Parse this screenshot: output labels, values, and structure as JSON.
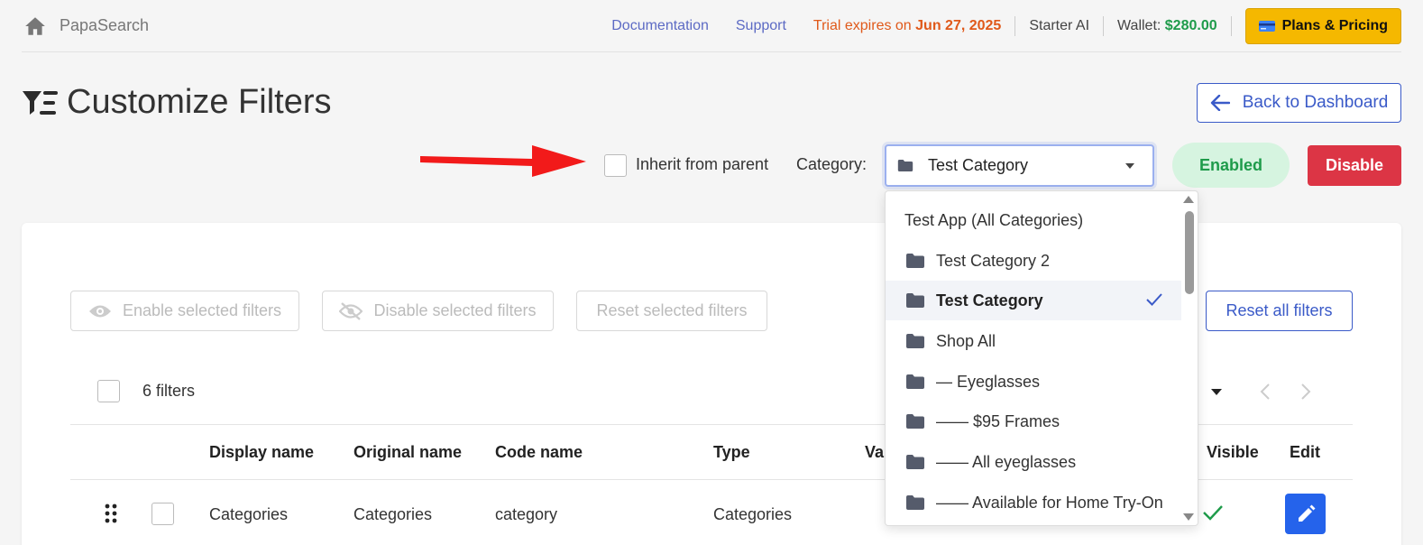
{
  "topbar": {
    "brand": "PapaSearch",
    "documentation": "Documentation",
    "support": "Support",
    "trial_prefix": "Trial expires on ",
    "trial_date": "Jun 27, 2025",
    "plan": "Starter AI",
    "wallet_label": "Wallet: ",
    "wallet_value": "$280.00",
    "plans_button": "Plans & Pricing"
  },
  "header": {
    "title": "Customize Filters",
    "back_button": "Back to Dashboard"
  },
  "controls": {
    "inherit_label": "Inherit from parent",
    "category_label": "Category:",
    "category_value": "Test Category",
    "status_badge": "Enabled",
    "disable_button": "Disable"
  },
  "actions": {
    "enable_selected": "Enable selected filters",
    "disable_selected": "Disable selected filters",
    "reset_selected": "Reset selected filters",
    "reset_all": "Reset all filters"
  },
  "list": {
    "count": "6 filters"
  },
  "table": {
    "headers": {
      "display_name": "Display name",
      "original_name": "Original name",
      "code_name": "Code name",
      "type": "Type",
      "values": "Va",
      "visible": "Visible",
      "edit": "Edit"
    },
    "rows": [
      {
        "display_name": "Categories",
        "original_name": "Categories",
        "code_name": "category",
        "type": "Categories",
        "visible": true
      }
    ]
  },
  "dropdown": {
    "items": [
      {
        "label": "Test App (All Categories)"
      },
      {
        "label": "Test Category 2"
      },
      {
        "label": "Test Category",
        "selected": true
      },
      {
        "label": "Shop All"
      },
      {
        "label": "— Eyeglasses"
      },
      {
        "label": "—— $95 Frames"
      },
      {
        "label": "—— All eyeglasses"
      },
      {
        "label": "—— Available for Home Try-On"
      }
    ]
  },
  "colors": {
    "accent": "#3a5ac8",
    "trial": "#e0591a",
    "wallet": "#1e9b4a",
    "plans": "#f5b800",
    "danger": "#dc3545",
    "edit": "#2563eb"
  }
}
